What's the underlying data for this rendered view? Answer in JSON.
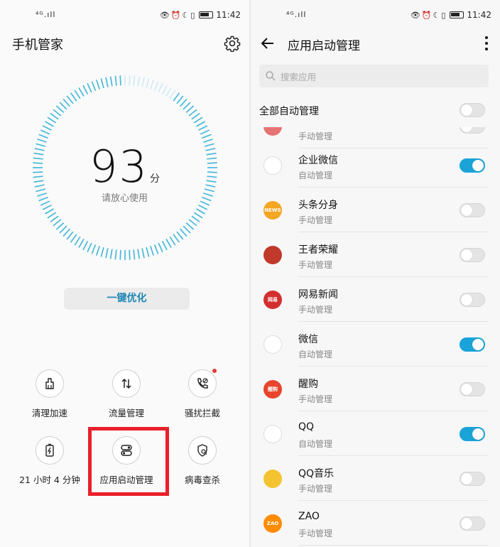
{
  "status_bar": {
    "network": "⁴ᴳ.ıll",
    "time": "11:42"
  },
  "left_screen": {
    "title": "手机管家",
    "score": "93",
    "score_unit": "分",
    "score_subtitle": "请放心使用",
    "optimize_button": "一键优化",
    "tools": [
      {
        "label": "清理加速",
        "icon": "broom-icon"
      },
      {
        "label": "流量管理",
        "icon": "data-arrows-icon"
      },
      {
        "label": "骚扰拦截",
        "icon": "phone-block-icon",
        "badge": true
      },
      {
        "label": "21 小时 4 分钟",
        "icon": "battery-icon"
      },
      {
        "label": "应用启动管理",
        "icon": "app-launch-icon"
      },
      {
        "label": "病毒查杀",
        "icon": "shield-search-icon"
      }
    ],
    "highlight_color": "#e8202a"
  },
  "right_screen": {
    "title": "应用启动管理",
    "search_placeholder": "搜索应用",
    "all_label": "全部自动管理",
    "all_toggle": false,
    "partial_item_sub": "手动管理",
    "apps": [
      {
        "name": "企业微信",
        "mode": "自动管理",
        "on": true,
        "icon": "wecom-icon",
        "color": "#ffffff"
      },
      {
        "name": "头条分身",
        "mode": "手动管理",
        "on": false,
        "icon": "news-icon",
        "color": "#f5a623",
        "badge_text": "NEWS"
      },
      {
        "name": "王者荣耀",
        "mode": "手动管理",
        "on": false,
        "icon": "honor-of-kings-icon",
        "color": "#c0392b"
      },
      {
        "name": "网易新闻",
        "mode": "手动管理",
        "on": false,
        "icon": "netease-news-icon",
        "color": "#d32f2f",
        "badge_text": "网易"
      },
      {
        "name": "微信",
        "mode": "自动管理",
        "on": true,
        "icon": "wechat-icon",
        "color": "#ffffff"
      },
      {
        "name": "醒购",
        "mode": "手动管理",
        "on": false,
        "icon": "xinggou-icon",
        "color": "#e8442e",
        "badge_text": "醒购"
      },
      {
        "name": "QQ",
        "mode": "自动管理",
        "on": true,
        "icon": "qq-icon",
        "color": "#ffffff"
      },
      {
        "name": "QQ音乐",
        "mode": "手动管理",
        "on": false,
        "icon": "qq-music-icon",
        "color": "#f4c430"
      },
      {
        "name": "ZAO",
        "mode": "手动管理",
        "on": false,
        "icon": "zao-icon",
        "color": "#ff8c00",
        "badge_text": "ZAO"
      }
    ],
    "accent_color": "#1aa3d9"
  }
}
